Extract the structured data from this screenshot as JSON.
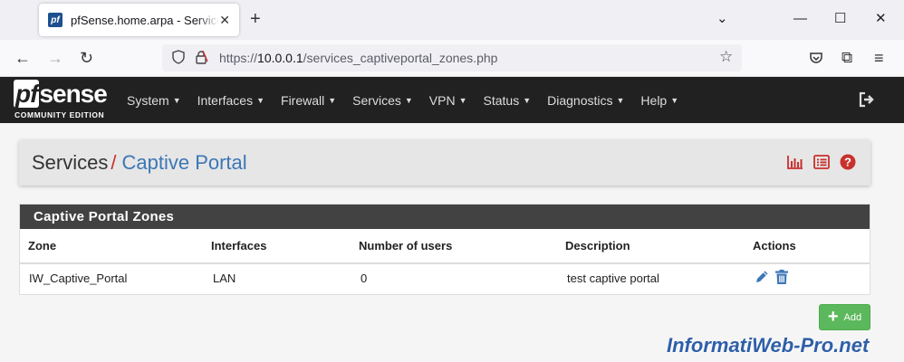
{
  "browser": {
    "tab_title": "pfSense.home.arpa - Services: Captive Portal",
    "favicon_text": "pf",
    "url_prefix": "https://",
    "url_host": "10.0.0.1",
    "url_path": "/services_captiveportal_zones.php"
  },
  "pfsense": {
    "logo_main_a": "pf",
    "logo_main_b": "sense",
    "logo_sub": "COMMUNITY EDITION",
    "menu": [
      "System",
      "Interfaces",
      "Firewall",
      "Services",
      "VPN",
      "Status",
      "Diagnostics",
      "Help"
    ]
  },
  "breadcrumb": {
    "root": "Services",
    "separator": "/",
    "current": "Captive Portal"
  },
  "panel": {
    "title": "Captive Portal Zones",
    "columns": [
      "Zone",
      "Interfaces",
      "Number of users",
      "Description",
      "Actions"
    ],
    "rows": [
      {
        "zone": "IW_Captive_Portal",
        "interfaces": "LAN",
        "users": "0",
        "description": "test captive portal"
      }
    ]
  },
  "add_button": {
    "label": "Add"
  },
  "watermark": "InformatiWeb-Pro.net",
  "colors": {
    "accent_red": "#c9302c",
    "link_blue": "#3c77b6",
    "panel_header": "#424242",
    "success_green": "#5cb85c",
    "navbar_dark": "#212121"
  }
}
